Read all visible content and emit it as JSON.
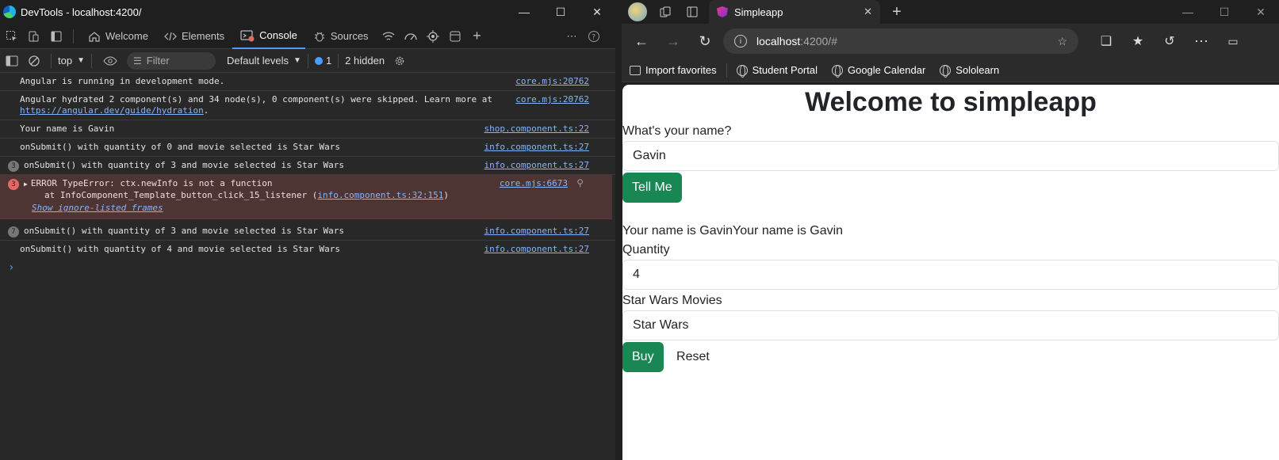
{
  "devtools": {
    "title": "DevTools - localhost:4200/",
    "tabs": [
      {
        "label": "Welcome",
        "icon": "home-icon"
      },
      {
        "label": "Elements",
        "icon": "code-icon"
      },
      {
        "label": "Console",
        "icon": "console-icon"
      },
      {
        "label": "Sources",
        "icon": "bug-icon"
      }
    ],
    "filter": {
      "context": "top",
      "placeholder": "Filter",
      "levels": "Default levels",
      "badge_count": "1",
      "hidden": "2 hidden"
    },
    "messages": [
      {
        "text": "Angular is running in development mode.",
        "source": "core.mjs:20762",
        "count": ""
      },
      {
        "text": "Angular hydrated 2 component(s) and 34 node(s), 0 component(s) were skipped. Learn more at",
        "link": "https://angular.dev/guide/hydration",
        "link_suffix": ".",
        "source": "core.mjs:20762",
        "count": ""
      },
      {
        "text": "Your name is Gavin",
        "source": "shop.component.ts:22",
        "count": ""
      },
      {
        "text": "onSubmit() with quantity of 0 and movie selected is Star Wars",
        "source": "info.component.ts:27",
        "count": ""
      },
      {
        "text": "onSubmit() with quantity of 3 and movie selected is Star Wars",
        "source": "info.component.ts:27",
        "count": "3"
      },
      {
        "text": "onSubmit() with quantity of 3 and movie selected is Star Wars",
        "source": "info.component.ts:27",
        "count": "7"
      },
      {
        "text": "onSubmit() with quantity of 4 and movie selected is Star Wars",
        "source": "info.component.ts:27",
        "count": ""
      }
    ],
    "error": {
      "count": "3",
      "line1": "ERROR TypeError: ctx.newInfo is not a function",
      "line2_prefix": "at InfoComponent_Template_button_click_15_listener (",
      "line2_link": "info.component.ts:32:151",
      "line2_suffix": ")",
      "show_frames": "Show ignore-listed frames",
      "source": "core.mjs:6673"
    }
  },
  "browser": {
    "tab_title": "Simpleapp",
    "url_host": "localhost",
    "url_path": ":4200/#",
    "favorites": [
      "Import favorites",
      "Student Portal",
      "Google Calendar",
      "Sololearn"
    ],
    "page": {
      "heading": "Welcome to simpleapp",
      "name_label": "What's your name?",
      "name_value": "Gavin",
      "tell_me": "Tell Me",
      "greeting": "Your name is GavinYour name is Gavin",
      "quantity_label": "Quantity",
      "quantity_value": "4",
      "movies_label": "Star Wars Movies",
      "movie_value": "Star Wars",
      "buy": "Buy",
      "reset": "Reset"
    }
  }
}
